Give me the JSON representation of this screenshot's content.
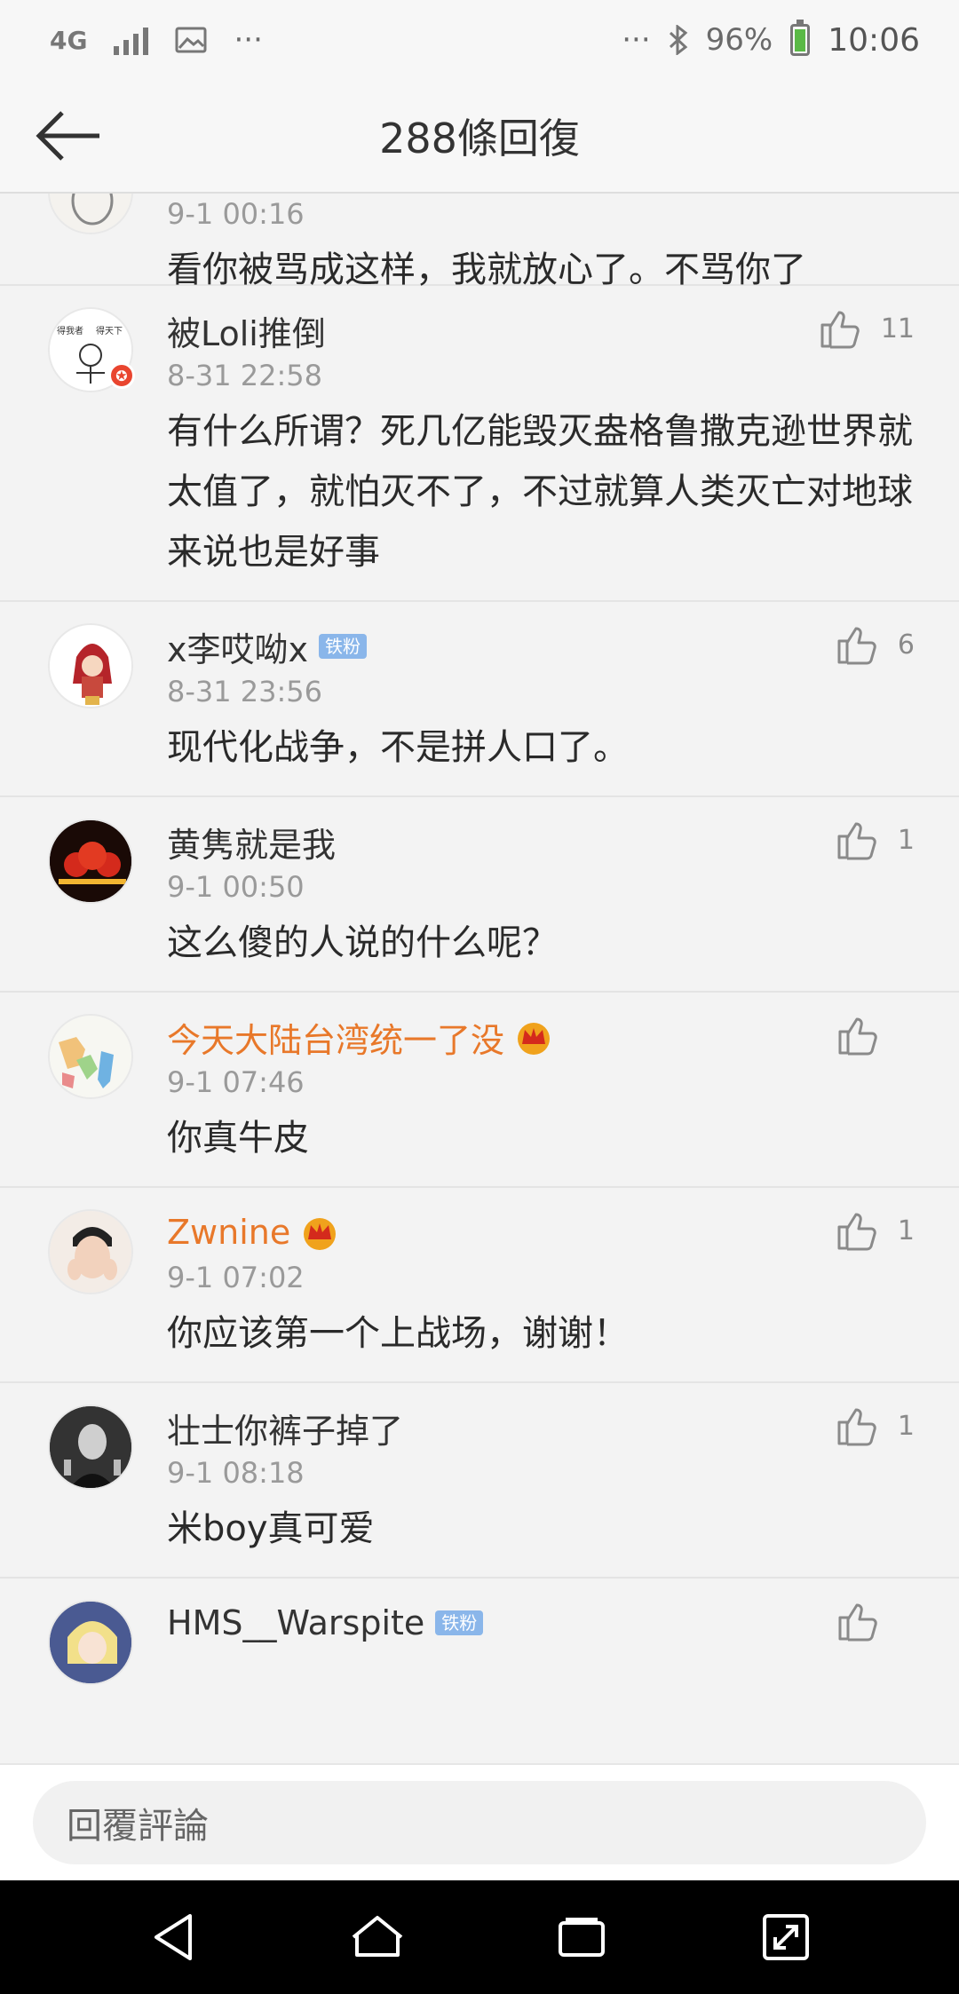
{
  "status_bar": {
    "network": "4G",
    "more_left": "···",
    "more_right": "···",
    "battery": "96%",
    "time": "10:06",
    "battery_color": "#5ab946"
  },
  "header": {
    "title": "288條回復"
  },
  "comments": [
    {
      "username": "",
      "time": "9-1 00:16",
      "text": "看你被骂成这样，我就放心了。不骂你了",
      "likes": ""
    },
    {
      "username": "被Loli推倒",
      "time": "8-31 22:58",
      "text": "有什么所谓？死几亿能毁灭盎格鲁撒克逊世界就太值了，就怕灭不了，不过就算人类灭亡对地球来说也是好事",
      "likes": "11",
      "avatar_text_left": "得我者",
      "avatar_text_right": "得天下"
    },
    {
      "username": "x李哎呦x",
      "badge": "铁粉",
      "time": "8-31 23:56",
      "text": "现代化战争，不是拼人口了。",
      "likes": "6"
    },
    {
      "username": "黄隽就是我",
      "time": "9-1 00:50",
      "text": "这么傻的人说的什么呢？",
      "likes": "1"
    },
    {
      "username": "今天大陆台湾统一了没",
      "time": "9-1 07:46",
      "text": "你真牛皮",
      "likes": ""
    },
    {
      "username": "Zwnine",
      "time": "9-1 07:02",
      "text": "你应该第一个上战场，谢谢！",
      "likes": "1"
    },
    {
      "username": "壮士你裤子掉了",
      "time": "9-1 08:18",
      "text": "米boy真可爱",
      "likes": "1"
    },
    {
      "username": "HMS__Warspite",
      "badge": "铁粉",
      "time": "",
      "text": "",
      "likes": ""
    }
  ],
  "reply": {
    "placeholder": "回覆評論"
  },
  "colors": {
    "vip_name": "#e8782a",
    "fan_badge": "#8ab6ea",
    "crown": "#f0a21c"
  }
}
